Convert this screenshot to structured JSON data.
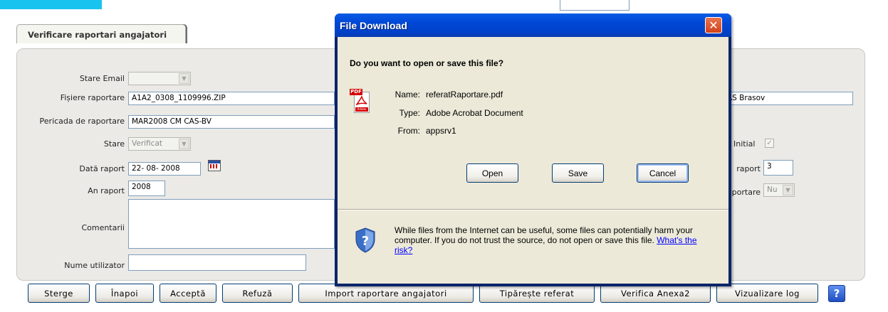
{
  "top": {
    "fragment": ""
  },
  "tab": {
    "label": "Verificare raportari angajatori"
  },
  "form": {
    "stare_email_label": "Stare Email",
    "fisiere_label": "Fișiere raportare",
    "fisiere_value": "A1A2_0308_1109996.ZIP",
    "perioada_label": "Pericada de raportare",
    "perioada_value": "MAR2008 CM CAS-BV",
    "stare_label": "Stare",
    "stare_value": "Verificat",
    "data_label": "Dată raport",
    "data_value": "22- 08- 2008",
    "an_label": "An raport",
    "an_value": "2008",
    "comentarii_label": "Comentarii",
    "nume_label": "Nume utilizator",
    "right_field_value": "AS Brasov",
    "initial_label": "Initial",
    "raport_label": "raport",
    "raport_value": "3",
    "raportare_label": "portare",
    "raportare_value": "Nu"
  },
  "buttons": {
    "sterge": "Sterge",
    "inapoi": "Înapoi",
    "accepta": "Acceptă",
    "refuza": "Refuză",
    "import": "Import raportare angajatori",
    "tipareste": "Tipărește referat",
    "verifica": "Verifica Anexa2",
    "log": "Vizualizare log",
    "help": "?"
  },
  "dialog": {
    "title": "File Download",
    "question": "Do you want to open or save this file?",
    "name_key": "Name:",
    "name_val": "referatRaportare.pdf",
    "type_key": "Type:",
    "type_val": "Adobe Acrobat Document",
    "from_key": "From:",
    "from_val": "appsrv1",
    "open": "Open",
    "save": "Save",
    "cancel": "Cancel",
    "warning": "While files from the Internet can be useful, some files can potentially harm your computer. If you do not trust the source, do not open or save this file.",
    "risk_link": "What's the risk?",
    "pdf_badge": "PDF",
    "adobe_text": "Adobe"
  },
  "colors": {
    "accent_cyan": "#19c3f0",
    "title_blue": "#0047d6",
    "dialog_bg": "#ece9d8"
  }
}
